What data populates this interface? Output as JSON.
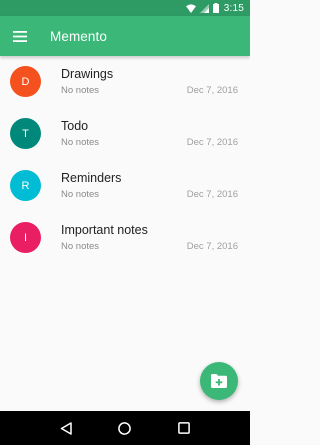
{
  "status_bar": {
    "time": "3:15",
    "icons": [
      "wifi-icon",
      "signal-icon",
      "battery-icon"
    ],
    "color": "#2e9a64"
  },
  "app_bar": {
    "title": "Memento",
    "menu_icon": "hamburger-menu-icon",
    "color": "#3bb878"
  },
  "notes": [
    {
      "initial": "D",
      "title": "Drawings",
      "subtitle": "No notes",
      "date": "Dec 7, 2016",
      "color": "#f4511e"
    },
    {
      "initial": "T",
      "title": "Todo",
      "subtitle": "No notes",
      "date": "Dec 7, 2016",
      "color": "#00897b"
    },
    {
      "initial": "R",
      "title": "Reminders",
      "subtitle": "No notes",
      "date": "Dec 7, 2016",
      "color": "#00bcd4"
    },
    {
      "initial": "I",
      "title": "Important notes",
      "subtitle": "No notes",
      "date": "Dec 7, 2016",
      "color": "#e91e63"
    }
  ],
  "fab": {
    "icon": "add-note-icon",
    "color": "#3bb878"
  },
  "nav_bar": {
    "buttons": [
      "back-icon",
      "home-icon",
      "recents-icon"
    ]
  }
}
